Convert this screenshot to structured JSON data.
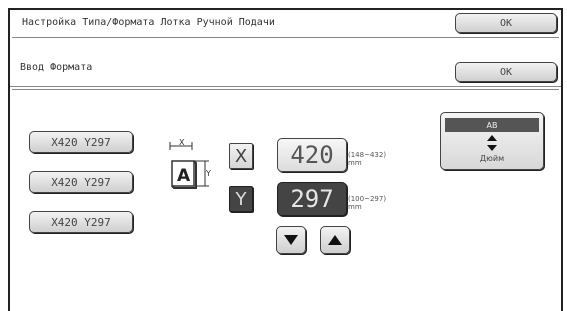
{
  "header": {
    "title": "Настройка Типа/Формата Лотка Ручной Подачи",
    "ok_label": "OK"
  },
  "subheader": {
    "title": "Ввод Формата",
    "ok_label": "OK"
  },
  "presets": [
    {
      "label": "X420 Y297"
    },
    {
      "label": "X420 Y297"
    },
    {
      "label": "X420 Y297"
    }
  ],
  "diagram": {
    "x_label": "X",
    "y_label": "Y",
    "letter": "A"
  },
  "inputs": {
    "x": {
      "axis": "X",
      "value": "420",
      "range": "(148~432)",
      "unit": "mm",
      "selected": false
    },
    "y": {
      "axis": "Y",
      "value": "297",
      "range": "(100~297)",
      "unit": "mm",
      "selected": true
    }
  },
  "arrows": {
    "down": "arrow-down-icon",
    "up": "arrow-up-icon"
  },
  "unit_toggle": {
    "selected": "AB",
    "alternative": "Дюйм",
    "icon": "up-down-arrows-icon"
  }
}
